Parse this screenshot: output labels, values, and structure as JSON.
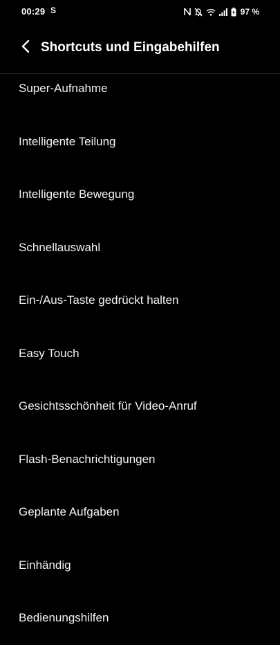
{
  "status_bar": {
    "time": "00:29",
    "app_icon": "S",
    "battery_percent": "97 %",
    "icons": [
      "nfc-icon",
      "mute-icon",
      "wifi-icon",
      "signal-icon",
      "battery-charging-icon"
    ]
  },
  "header": {
    "title": "Shortcuts und Eingabehilfen",
    "back_icon": "chevron-left-icon"
  },
  "items": [
    {
      "label": "Super-Aufnahme"
    },
    {
      "label": "Intelligente Teilung"
    },
    {
      "label": "Intelligente Bewegung"
    },
    {
      "label": "Schnellauswahl"
    },
    {
      "label": "Ein-/Aus-Taste gedrückt halten"
    },
    {
      "label": "Easy Touch"
    },
    {
      "label": "Gesichtsschönheit für Video-Anruf"
    },
    {
      "label": "Flash-Benachrichtigungen"
    },
    {
      "label": "Geplante Aufgaben"
    },
    {
      "label": "Einhändig"
    },
    {
      "label": "Bedienungshilfen"
    }
  ],
  "colors": {
    "background": "#000000",
    "text": "#ffffff",
    "divider": "#262626"
  }
}
